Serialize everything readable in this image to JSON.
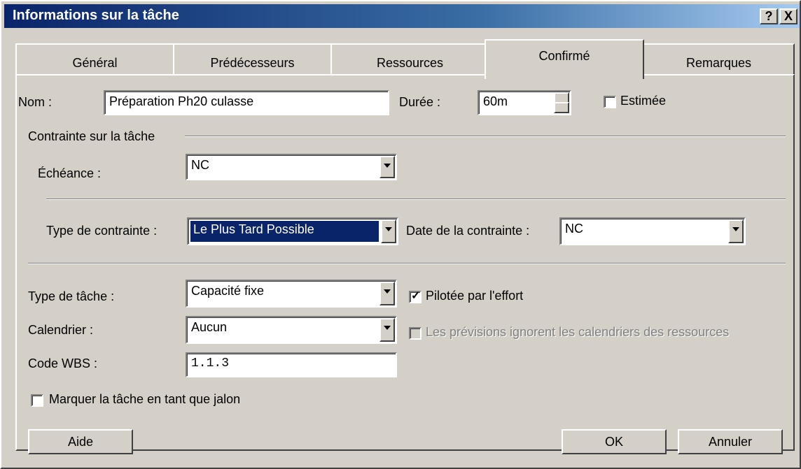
{
  "window": {
    "title": "Informations sur la tâche",
    "help_button": "?",
    "close_button": "X"
  },
  "tabs": [
    {
      "label": "Général"
    },
    {
      "label": "Prédécesseurs"
    },
    {
      "label": "Ressources"
    },
    {
      "label": "Confirmé"
    },
    {
      "label": "Remarques"
    }
  ],
  "active_tab": "Confirmé",
  "form": {
    "name_label": "Nom :",
    "name_value": "Préparation Ph20 culasse",
    "duration_label": "Durée :",
    "duration_value": "60m",
    "estimated_label": "Estimée",
    "estimated_checked": false,
    "constraint_group_label": "Contrainte sur la tâche",
    "deadline_label": "Échéance :",
    "deadline_value": "NC",
    "constraint_type_label": "Type de contrainte :",
    "constraint_type_value": "Le Plus Tard Possible",
    "constraint_date_label": "Date de la contrainte :",
    "constraint_date_value": "NC",
    "task_type_label": "Type de tâche :",
    "task_type_value": "Capacité fixe",
    "effort_driven_label": "Pilotée par l'effort",
    "effort_driven_checked": true,
    "calendar_label": "Calendrier :",
    "calendar_value": "Aucun",
    "ignore_resource_calendars_label": "Les prévisions ignorent les calendriers des ressources",
    "ignore_resource_calendars_checked": false,
    "wbs_label": "Code WBS :",
    "wbs_value": "1.1.3",
    "milestone_label": "Marquer la tâche en tant que jalon",
    "milestone_checked": false
  },
  "buttons": {
    "help": "Aide",
    "ok": "OK",
    "cancel": "Annuler"
  }
}
